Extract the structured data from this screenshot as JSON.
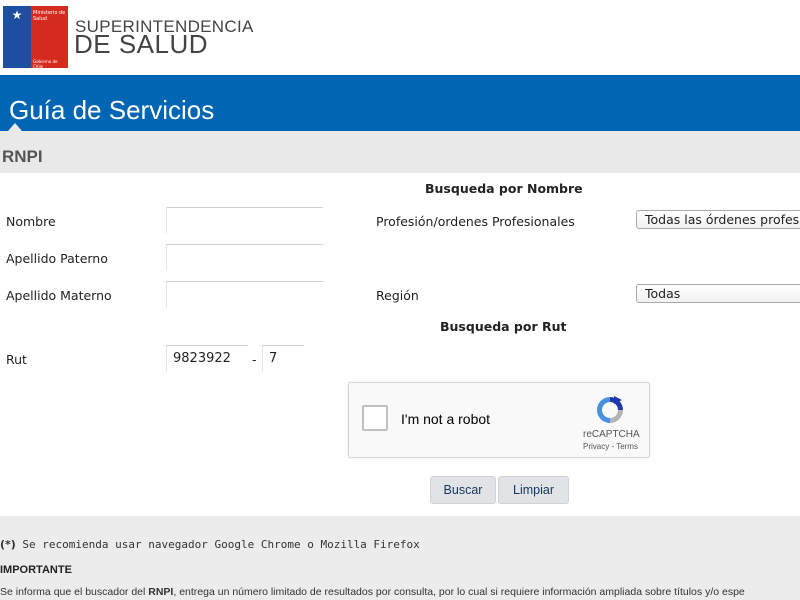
{
  "header": {
    "ministry_label": "Ministerio de Salud",
    "government_label": "Gobierno de Chile",
    "brand_line1": "SUPERINTENDENCIA",
    "brand_line2": "DE SALUD",
    "banner_title": "Guía de Servicios",
    "section_title": "RNPI"
  },
  "search_by_name": {
    "heading": "Busqueda por Nombre",
    "nombre_label": "Nombre",
    "nombre_value": "",
    "apellido_paterno_label": "Apellido Paterno",
    "apellido_paterno_value": "",
    "apellido_materno_label": "Apellido Materno",
    "apellido_materno_value": "",
    "profesion_label": "Profesión/ordenes Profesionales",
    "profesion_selected": "Todas las órdenes profesio",
    "region_label": "Región",
    "region_selected": "Todas"
  },
  "search_by_rut": {
    "heading": "Busqueda por Rut",
    "rut_label": "Rut",
    "rut_number": "9823922",
    "separator": "-",
    "rut_dv": "7"
  },
  "captcha": {
    "label": "I'm not a robot",
    "brand": "reCAPTCHA",
    "links": "Privacy - Terms"
  },
  "buttons": {
    "search": "Buscar",
    "clear": "Limpiar"
  },
  "footer": {
    "asterisk": "(*)",
    "recommendation": " Se recomienda usar navegador Google Chrome o Mozilla Firefox",
    "important": "IMPORTANTE",
    "info_prefix": "Se informa que el buscador del ",
    "info_bold": "RNPI",
    "info_suffix": ", entrega un número limitado de resultados por consulta, por lo cual si requiere información ampliada sobre títulos y/o espe"
  },
  "colors": {
    "banner_blue": "#0066b3",
    "flag_blue": "#1c4fa0",
    "flag_red": "#d52b1e",
    "section_gray": "#e9e9e9"
  }
}
